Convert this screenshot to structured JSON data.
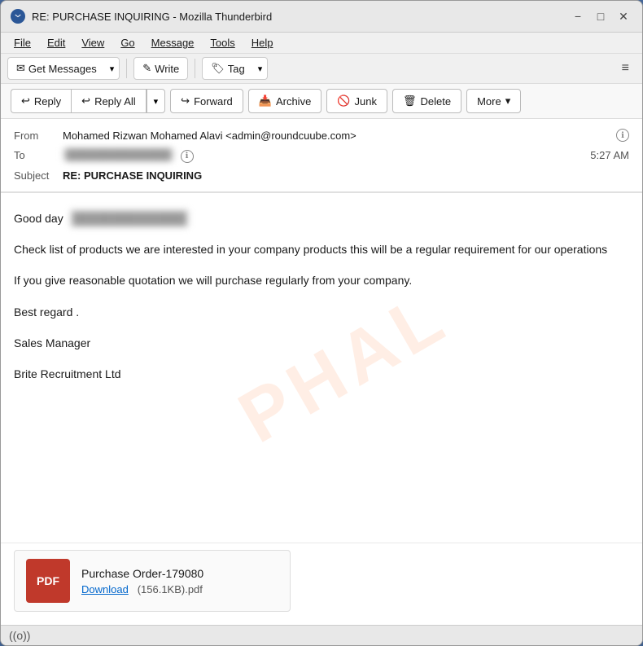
{
  "window": {
    "title": "RE: PURCHASE INQUIRING - Mozilla Thunderbird",
    "minimize_label": "−",
    "maximize_label": "□",
    "close_label": "✕"
  },
  "menu": {
    "items": [
      "File",
      "Edit",
      "View",
      "Go",
      "Message",
      "Tools",
      "Help"
    ]
  },
  "toolbar": {
    "get_messages_label": "Get Messages",
    "write_label": "Write",
    "tag_label": "Tag",
    "hamburger_label": "≡"
  },
  "action_bar": {
    "reply_label": "Reply",
    "reply_all_label": "Reply All",
    "forward_label": "Forward",
    "archive_label": "Archive",
    "junk_label": "Junk",
    "delete_label": "Delete",
    "more_label": "More"
  },
  "email": {
    "from_label": "From",
    "from_value": "Mohamed Rizwan Mohamed Alavi <admin@roundcuube.com>",
    "to_label": "To",
    "to_value": "██████████████",
    "time": "5:27 AM",
    "subject_label": "Subject",
    "subject_value": "RE: PURCHASE INQUIRING",
    "greeting": "Good day",
    "greeting_name": "██████████████",
    "body_para1": "Check list of products we are interested in your company products this will be a regular requirement for our operations",
    "body_para2": "If you give reasonable quotation we will purchase regularly from your company.",
    "body_para3": "Best regard .",
    "signature_line1": "Sales Manager",
    "signature_line2": "Brite Recruitment Ltd"
  },
  "attachment": {
    "pdf_label": "PDF",
    "filename": "Purchase Order-179080",
    "download_label": "Download",
    "size": "(156.1KB).pdf"
  },
  "status_bar": {
    "wifi_icon": "((o))"
  }
}
